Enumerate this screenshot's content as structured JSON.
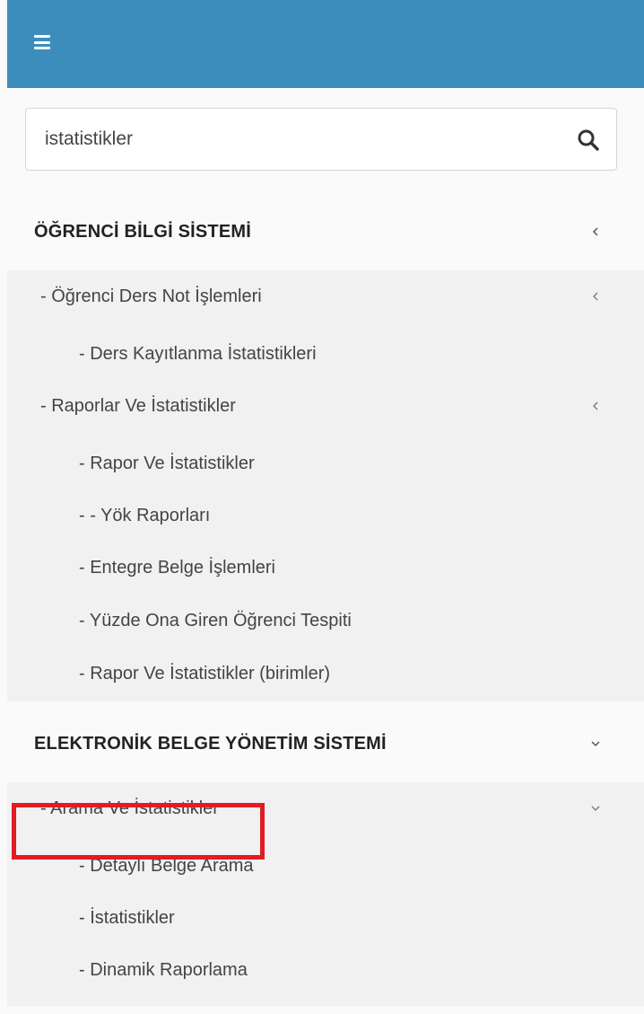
{
  "topbar": {
    "menu_icon": "hamburger-menu-icon",
    "color": "#3c8dbc"
  },
  "search": {
    "value": "istatistikler",
    "placeholder": "",
    "icon": "search-icon"
  },
  "sections": [
    {
      "title": "ÖĞRENCİ BİLGİ SİSTEMİ",
      "chevron": "chevron-left-icon",
      "items": [
        {
          "label": "- Öğrenci Ders Not İşlemleri",
          "level": 1,
          "chevron": "chevron-left-icon"
        },
        {
          "label": "- Ders Kayıtlanma İstatistikleri",
          "level": 2
        },
        {
          "label": "- Raporlar Ve İstatistikler",
          "level": 1,
          "chevron": "chevron-left-icon"
        },
        {
          "label": "- Rapor Ve İstatistikler",
          "level": 2
        },
        {
          "label": "- - Yök Raporları",
          "level": 2
        },
        {
          "label": "- Entegre Belge İşlemleri",
          "level": 2
        },
        {
          "label": "- Yüzde Ona Giren Öğrenci Tespiti",
          "level": 2
        },
        {
          "label": "- Rapor Ve İstatistikler (birimler)",
          "level": 2
        }
      ]
    },
    {
      "title": "ELEKTRONİK BELGE YÖNETİM SİSTEMİ",
      "chevron": "chevron-down-icon",
      "items": [
        {
          "label": "- Arama Ve İstatistikler",
          "level": 1,
          "chevron": "chevron-down-icon"
        },
        {
          "label": "- Detaylı Belge Arama",
          "level": 2
        },
        {
          "label": "- İstatistikler",
          "level": 2,
          "highlighted": true
        },
        {
          "label": "- Dinamik Raporlama",
          "level": 2
        }
      ]
    }
  ],
  "highlight_color": "#e31b23"
}
